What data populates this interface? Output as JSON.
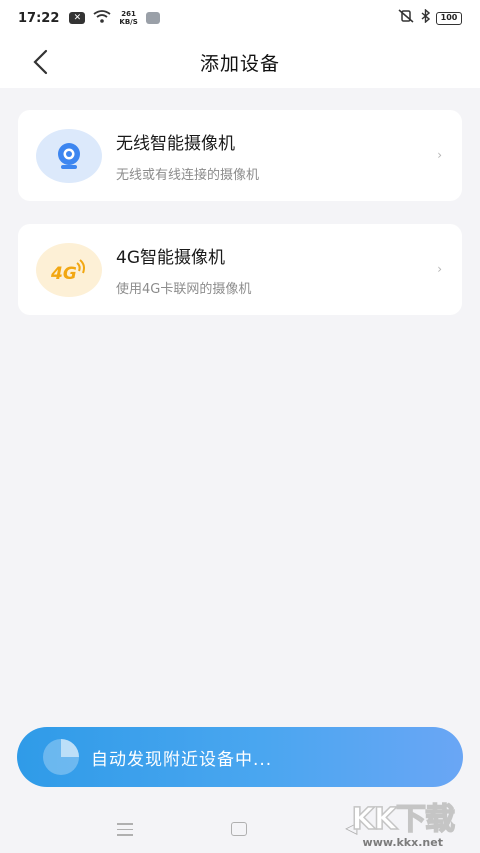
{
  "status_bar": {
    "time": "17:22",
    "net_speed": "261",
    "net_unit": "KB/S",
    "battery": "100"
  },
  "header": {
    "title": "添加设备"
  },
  "devices": [
    {
      "title": "无线智能摄像机",
      "subtitle": "无线或有线连接的摄像机",
      "icon": "camera-icon",
      "color": "#3d86f0"
    },
    {
      "title": "4G智能摄像机",
      "subtitle": "使用4G卡联网的摄像机",
      "icon": "4g-icon",
      "icon_text": "4G",
      "color": "#f2a712"
    }
  ],
  "discover": {
    "label": "自动发现附近设备中..."
  },
  "watermark": {
    "logo": "KK下载",
    "url": "www.kkx.net"
  },
  "colors": {
    "accent": "#3d9ff0",
    "background": "#f4f4f7",
    "card": "#ffffff"
  }
}
